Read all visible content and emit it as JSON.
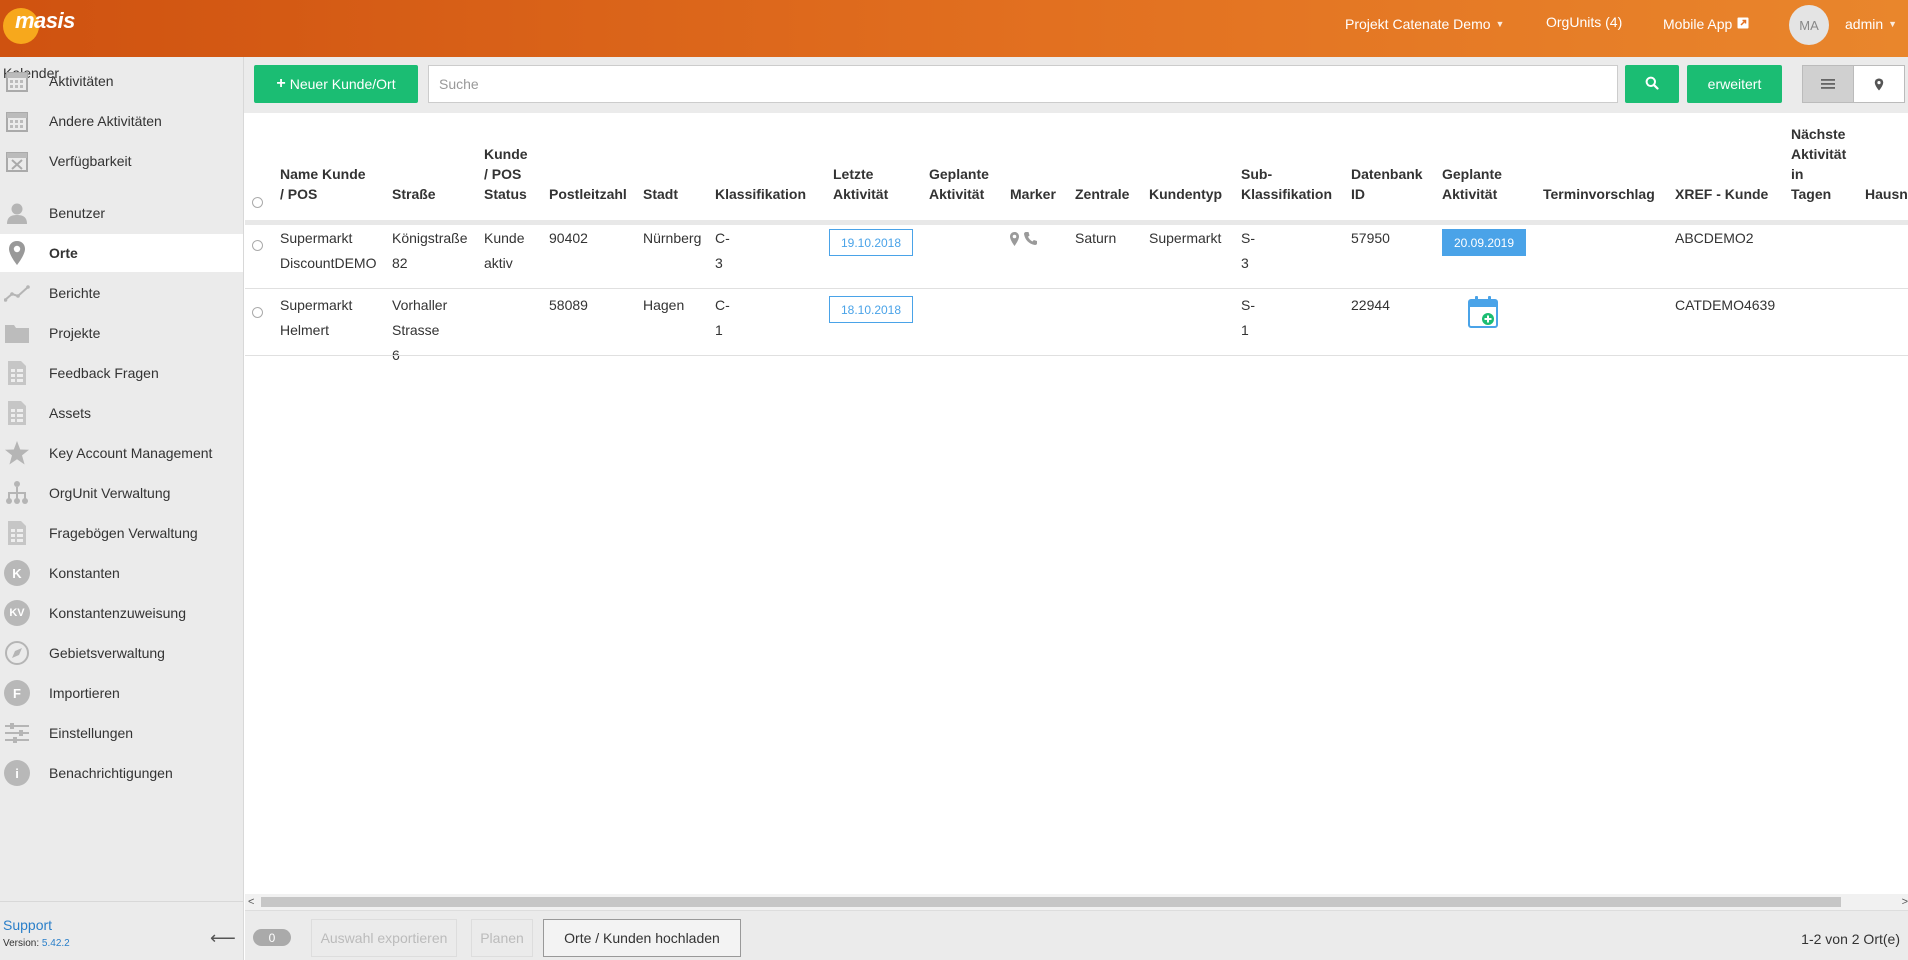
{
  "header": {
    "logo_text": "masis",
    "project": "Projekt Catenate Demo",
    "orgunits": "OrgUnits (4)",
    "mobile_app": "Mobile App",
    "avatar_initials": "MA",
    "user": "admin"
  },
  "sidebar": {
    "section_label": "Kalender",
    "items": [
      {
        "label": "Aktivitäten",
        "icon": "calendar-icon"
      },
      {
        "label": "Andere Aktivitäten",
        "icon": "calendar-icon"
      },
      {
        "label": "Verfügbarkeit",
        "icon": "calendar-x-icon"
      },
      {
        "label": "Benutzer",
        "icon": "user-icon"
      },
      {
        "label": "Orte",
        "icon": "map-pin-icon",
        "active": true
      },
      {
        "label": "Berichte",
        "icon": "line-chart-icon"
      },
      {
        "label": "Projekte",
        "icon": "folder-icon"
      },
      {
        "label": "Feedback Fragen",
        "icon": "document-grid-icon"
      },
      {
        "label": "Assets",
        "icon": "document-grid-icon"
      },
      {
        "label": "Key Account Management",
        "icon": "star-icon"
      },
      {
        "label": "OrgUnit Verwaltung",
        "icon": "org-tree-icon"
      },
      {
        "label": "Fragebögen Verwaltung",
        "icon": "document-grid-icon"
      },
      {
        "label": "Konstanten",
        "icon": "k-circle-icon",
        "glyph": "K"
      },
      {
        "label": "Konstantenzuweisung",
        "icon": "kv-circle-icon",
        "glyph": "KV"
      },
      {
        "label": "Gebietsverwaltung",
        "icon": "compass-icon"
      },
      {
        "label": "Importieren",
        "icon": "f-circle-icon",
        "glyph": "F"
      },
      {
        "label": "Einstellungen",
        "icon": "sliders-icon"
      },
      {
        "label": "Benachrichtigungen",
        "icon": "info-icon",
        "glyph": "i"
      }
    ],
    "support": "Support",
    "version_label": "Version:",
    "version": "5.42.2"
  },
  "toolbar": {
    "new_button": "Neuer Kunde/Ort",
    "search_placeholder": "Suche",
    "advanced_button": "erweitert"
  },
  "table": {
    "headers": [
      "Name Kunde / POS",
      "Straße",
      "Kunde / POS Status",
      "Postleitzahl",
      "Stadt",
      "Klassifikation",
      "Letzte Aktivität",
      "Geplante Aktivität",
      "Marker",
      "Zentrale",
      "Kundentyp",
      "Sub-Klassifikation",
      "Datenbank ID",
      "Geplante Aktivität",
      "Terminvorschlag",
      "XREF - Kunde",
      "Nächste Aktivität in Tagen",
      "Hausn"
    ],
    "rows": [
      {
        "name_1": "Supermarkt",
        "name_2": "DiscountDEMO",
        "street_1": "Königstraße",
        "street_2": "82",
        "status_1": "Kunde",
        "status_2": "aktiv",
        "zip": "90402",
        "city": "Nürnberg",
        "class": "C-3",
        "last_activity": "19.10.2018",
        "zentrale": "Saturn",
        "kundentyp": "Supermarkt",
        "subclass": "S-3",
        "db_id": "57950",
        "planned": "20.09.2019",
        "xref": "ABCDEMO2"
      },
      {
        "name_1": "Supermarkt",
        "name_2": "Helmert",
        "street_1": "Vorhaller",
        "street_2": "Strasse 6",
        "zip": "58089",
        "city": "Hagen",
        "class": "C-1",
        "last_activity": "18.10.2018",
        "subclass": "S-1",
        "db_id": "22944",
        "xref": "CATDEMO4639"
      }
    ]
  },
  "footer": {
    "selected_count": "0",
    "export_button": "Auswahl exportieren",
    "plan_button": "Planen",
    "upload_button": "Orte / Kunden hochladen",
    "page_info": "1-2 von 2 Ort(e)"
  },
  "colors": {
    "header_start": "#cf5210",
    "header_end": "#e9862c",
    "green": "#1bbd73",
    "blue": "#4aa3e8",
    "link": "#2a7fc9"
  }
}
